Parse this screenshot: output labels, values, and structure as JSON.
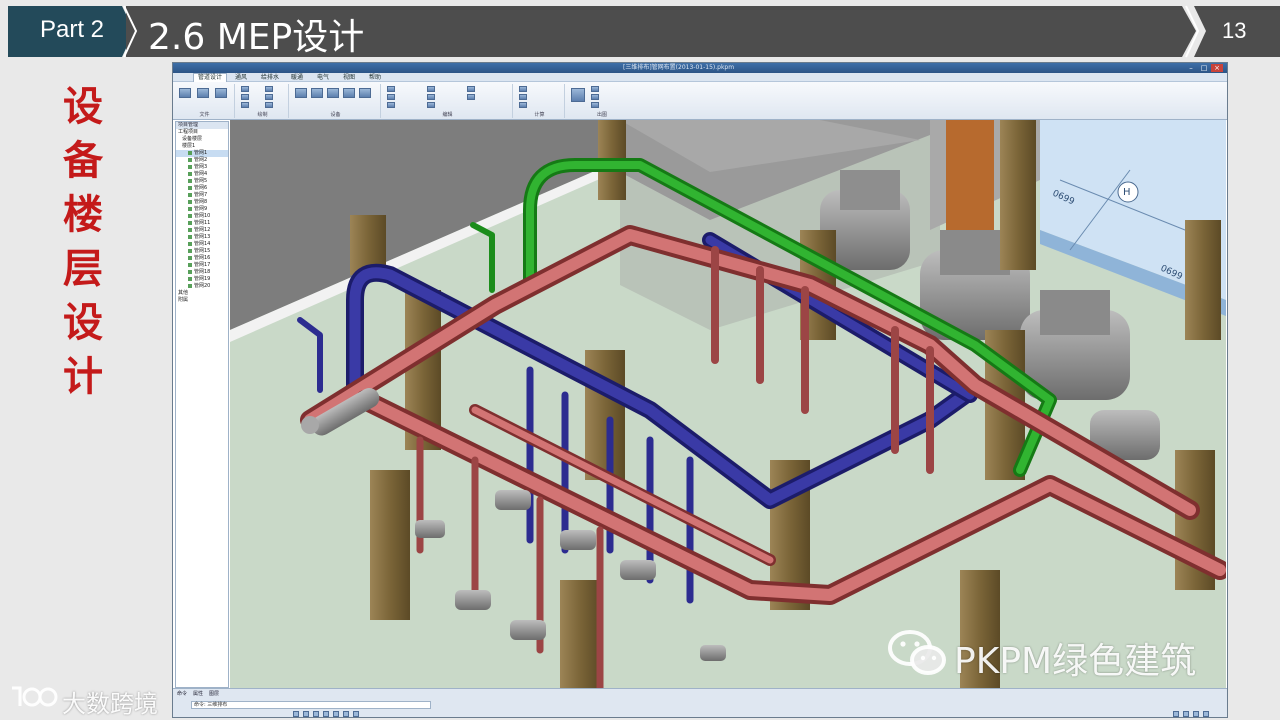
{
  "header": {
    "part_label": "Part 2",
    "title": "2.6 MEP设计",
    "page_number": "13"
  },
  "side_title": "设备楼层设计",
  "app": {
    "window_title": "[三维排布]管网布置(2013-01-15).pkpm",
    "tabs": [
      {
        "label": "管道设计"
      },
      {
        "label": "通风"
      },
      {
        "label": "给排水"
      },
      {
        "label": "暖通"
      },
      {
        "label": "电气"
      },
      {
        "label": "视图"
      },
      {
        "label": "帮助"
      }
    ],
    "ribbon_groups": [
      {
        "label": "文件"
      },
      {
        "label": "绘制"
      },
      {
        "label": "设备"
      },
      {
        "label": "编辑"
      },
      {
        "label": "计算"
      },
      {
        "label": "出图"
      }
    ],
    "tree": {
      "header": "项目管理",
      "items": [
        "工程项目",
        "设备楼层",
        "楼层1",
        "管网1",
        "管网2",
        "管网3",
        "管网4",
        "管网5",
        "管网6",
        "管网7",
        "管网8",
        "管网9",
        "管网10",
        "管网11",
        "管网12",
        "管网13",
        "管网14",
        "管网15",
        "管网16",
        "管网17",
        "管网18",
        "管网19",
        "管网20",
        "其他",
        "附属"
      ]
    },
    "status": {
      "tabs": [
        "命令",
        "属性",
        "图层"
      ],
      "command_text": "命令: 三维排布"
    },
    "dimension_labels": [
      "0699",
      "0699"
    ],
    "axis_label": "H"
  },
  "watermarks": {
    "right": "PKPM绿色建筑",
    "left": "大数跨境"
  }
}
